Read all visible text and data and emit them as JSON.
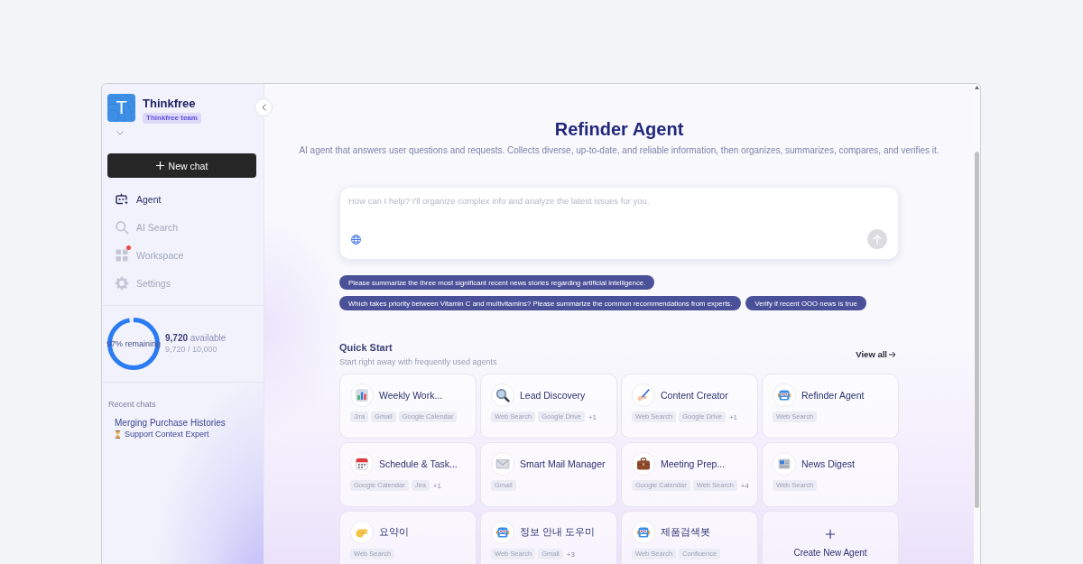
{
  "sidebar": {
    "workspace": {
      "logo_letter": "T",
      "name": "Thinkfree",
      "team": "Thinkfree team"
    },
    "new_chat_button": "New chat",
    "nav_items": [
      {
        "kind": "agent",
        "label": "Agent",
        "disabled": false,
        "notification": false
      },
      {
        "kind": "search",
        "label": "AI Search",
        "disabled": true,
        "notification": false
      },
      {
        "kind": "workspace",
        "label": "Workspace",
        "disabled": true,
        "notification": true
      },
      {
        "kind": "settings",
        "label": "Settings",
        "disabled": true,
        "notification": false
      }
    ],
    "credits": {
      "ring_label": "97% remaining",
      "level": 0.972,
      "available": "**9,720** available",
      "usage": "9,720 / 10,000"
    },
    "recent_chats": {
      "heading": "Recent chats",
      "items": [
        {
          "title": "Merging Purchase Histories",
          "agent": "Support Context Expert"
        }
      ]
    }
  },
  "main": {
    "title": "Refinder Agent",
    "subtitle": "AI agent that answers user questions and requests. Collects diverse, up-to-date, and reliable information, then organizes, summarizes, compares, and verifies it.",
    "prompt": {
      "placeholder": "How can I help? I'll organize complex info and analyze the latest issues for you."
    },
    "suggestions": [
      "Please summarize the three most significant recent news stories regarding artificial intelligence.",
      "Which takes priority between Vitamin C and multivitamins? Please summarize the common recommendations from experts.",
      "Verify if recent OOO news is true"
    ],
    "quick_start": {
      "title": "Quick Start",
      "subtitle": "Start right away with frequently used agents",
      "view_all": "View all",
      "agents": [
        {
          "kind": "chart",
          "name": "Weekly Work...",
          "tags": [
            "Jira",
            "Gmail",
            "Google Calendar"
          ]
        },
        {
          "kind": "magnifier",
          "name": "Lead Discovery",
          "tags": [
            "Web Search",
            "Google Drive"
          ],
          "more": "+1"
        },
        {
          "kind": "writing-hand",
          "name": "Content Creator",
          "tags": [
            "Web Search",
            "Google Drive"
          ],
          "more": "+1"
        },
        {
          "kind": "robot",
          "name": "Refinder Agent",
          "tags": [
            "Web Search"
          ]
        },
        {
          "kind": "calendar",
          "name": "Schedule & Task...",
          "tags": [
            "Google Calendar",
            "Jira"
          ],
          "more": "+1"
        },
        {
          "kind": "envelope",
          "name": "Smart Mail Manager",
          "tags": [
            "Gmail"
          ]
        },
        {
          "kind": "briefcase",
          "name": "Meeting Prep...",
          "tags": [
            "Google Calendar",
            "Web Search"
          ],
          "more": "+4"
        },
        {
          "kind": "newspaper",
          "name": "News Digest",
          "tags": [
            "Web Search"
          ]
        },
        {
          "kind": "pinching-hand",
          "name": "요약이",
          "tags": [
            "Web Search"
          ]
        },
        {
          "kind": "robot",
          "name": "정보 안내 도우미",
          "tags": [
            "Web Search",
            "Gmail"
          ],
          "more": "+3"
        },
        {
          "kind": "robot",
          "name": "제품검색봇",
          "tags": [
            "Web Search",
            "Confluence"
          ]
        }
      ],
      "create_label": "Create New Agent"
    }
  }
}
